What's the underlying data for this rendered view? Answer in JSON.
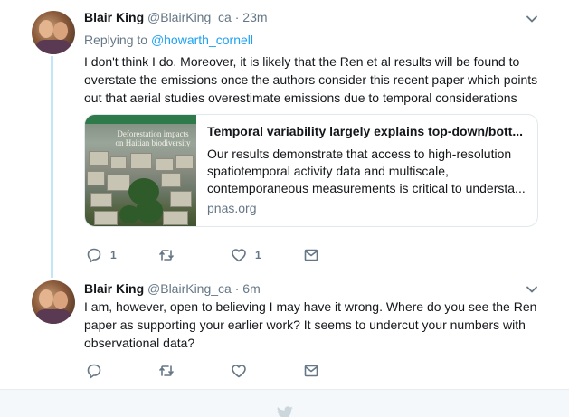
{
  "tweets": [
    {
      "author_name": "Blair King",
      "handle": "@BlairKing_ca",
      "separator": "·",
      "time": "23m",
      "replying_to_prefix": "Replying to",
      "replying_to_handle": "@howarth_cornell",
      "text": "I don't think I do. Moreover, it is likely that the Ren et al results will be found to overstate the emissions once the authors consider this recent paper which points out that aerial studies overestimate emissions due to temporal considerations",
      "card": {
        "image_overlay_text": "Deforestation impacts on Haitian biodiversity",
        "title": "Temporal variability largely explains top-down/bott...",
        "description": "Our results demonstrate that access to high-resolution spatiotemporal activity data and multiscale, contemporaneous measurements is critical to understa...",
        "domain": "pnas.org"
      },
      "actions": {
        "reply_count": "1",
        "retweet_count": "",
        "like_count": "1",
        "message_count": ""
      }
    },
    {
      "author_name": "Blair King",
      "handle": "@BlairKing_ca",
      "separator": "·",
      "time": "6m",
      "text": "I am, however, open to believing I may have it wrong. Where do you see the Ren paper as supporting your earlier work? It seems to undercut your numbers with observational data?",
      "actions": {
        "reply_count": "",
        "retweet_count": "",
        "like_count": "",
        "message_count": ""
      }
    }
  ],
  "icons": {
    "reply": "reply-icon",
    "retweet": "retweet-icon",
    "like": "heart-icon",
    "message": "envelope-icon",
    "caret": "chevron-down-icon",
    "footer": "bird-logo-icon"
  },
  "colors": {
    "link": "#1da1f2",
    "muted": "#657786",
    "thread_line": "#c4e4f8",
    "border": "#e1e8ed"
  }
}
